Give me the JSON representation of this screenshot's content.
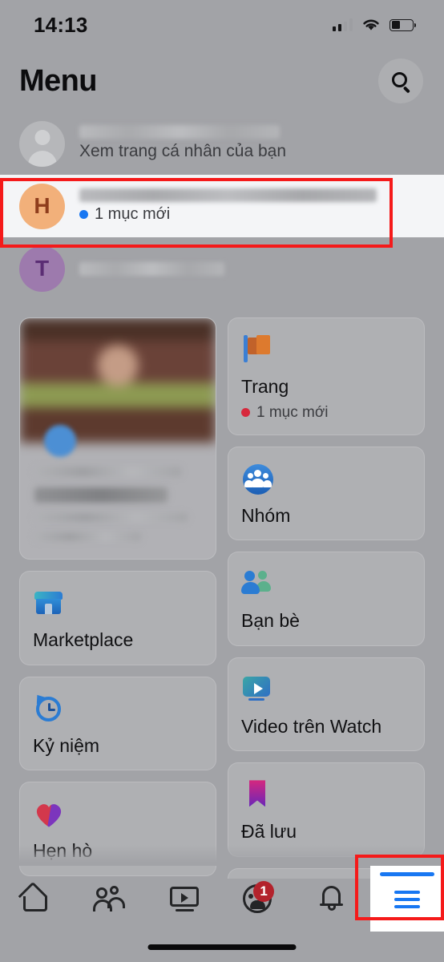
{
  "status_bar": {
    "time": "14:13",
    "signal_icon": "cellular-signal-icon",
    "wifi_icon": "wifi-icon",
    "battery_icon": "battery-icon"
  },
  "header": {
    "title": "Menu",
    "search_icon": "search-icon"
  },
  "accounts": [
    {
      "avatar_letter": "",
      "avatar_type": "placeholder",
      "name": "",
      "subtitle": "Xem trang cá nhân của bạn",
      "meta": "",
      "dot_color": "",
      "highlighted": false
    },
    {
      "avatar_letter": "H",
      "avatar_type": "letter",
      "avatar_bg": "#f2b07a",
      "avatar_fg": "#8f3d1c",
      "name": "",
      "subtitle": "",
      "meta": "1 mục mới",
      "dot_color": "#1877f2",
      "highlighted": true
    },
    {
      "avatar_letter": "T",
      "avatar_type": "letter",
      "avatar_bg": "#9d7aad",
      "avatar_fg": "#5b2d74",
      "name": "",
      "subtitle": "",
      "meta": "",
      "dot_color": "",
      "highlighted": false
    }
  ],
  "left_column": [
    {
      "kind": "promo",
      "label": "",
      "icon": "promo-image"
    },
    {
      "kind": "tile",
      "label": "Marketplace",
      "icon": "marketplace-icon"
    },
    {
      "kind": "tile",
      "label": "Kỷ niệm",
      "icon": "memories-clock-icon"
    },
    {
      "kind": "tile",
      "label": "Hẹn hò",
      "icon": "dating-heart-icon"
    },
    {
      "kind": "partial",
      "label": "",
      "icon": ""
    }
  ],
  "right_column": [
    {
      "kind": "tile",
      "label": "Trang",
      "icon": "pages-flag-icon",
      "meta": "1 mục mới",
      "dot_color": "#d7283c"
    },
    {
      "kind": "tile",
      "label": "Nhóm",
      "icon": "groups-icon",
      "meta": "",
      "dot_color": ""
    },
    {
      "kind": "tile",
      "label": "Bạn bè",
      "icon": "friends-icon",
      "meta": "",
      "dot_color": ""
    },
    {
      "kind": "tile",
      "label": "Video trên Watch",
      "icon": "watch-video-icon",
      "meta": "",
      "dot_color": ""
    },
    {
      "kind": "tile",
      "label": "Đã lưu",
      "icon": "saved-bookmark-icon",
      "meta": "",
      "dot_color": ""
    },
    {
      "kind": "partial",
      "label": "",
      "icon": "events-icon",
      "meta": "",
      "dot_color": ""
    }
  ],
  "bottom_nav": {
    "items": [
      {
        "icon": "home-icon",
        "label": "",
        "badge": "",
        "active": false
      },
      {
        "icon": "friends-nav-icon",
        "label": "",
        "badge": "",
        "active": false
      },
      {
        "icon": "watch-nav-icon",
        "label": "",
        "badge": "",
        "active": false
      },
      {
        "icon": "groups-nav-icon",
        "label": "",
        "badge": "1",
        "active": false
      },
      {
        "icon": "notifications-bell-icon",
        "label": "",
        "badge": "",
        "active": false
      },
      {
        "icon": "hamburger-menu-icon",
        "label": "",
        "badge": "",
        "active": true
      }
    ]
  },
  "annotations": {
    "highlight_color": "#f51a1a",
    "boxes": [
      {
        "name": "account-row-highlight-box"
      },
      {
        "name": "menu-tab-highlight-box"
      }
    ]
  },
  "accent_colors": {
    "facebook_blue": "#1877f2",
    "badge_red": "#b3222c",
    "page_background": "#a2a3a7"
  }
}
